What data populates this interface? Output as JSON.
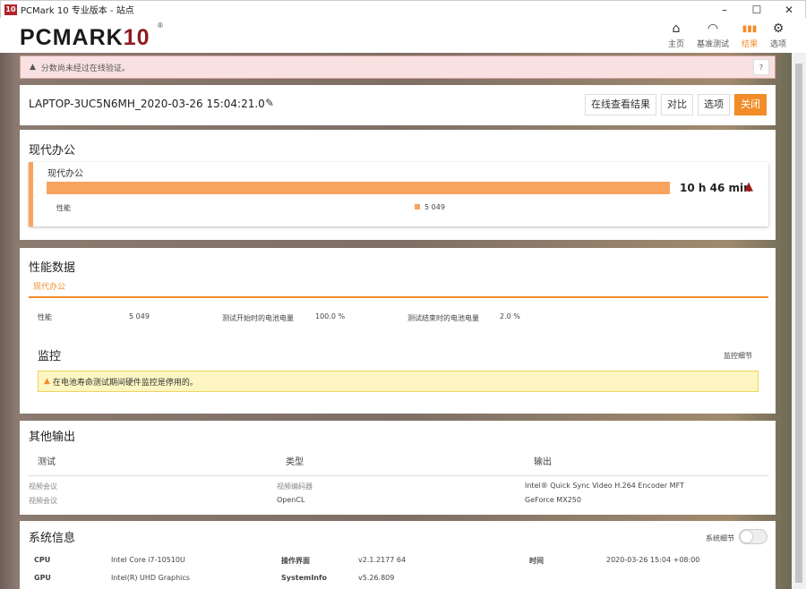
{
  "window": {
    "icon_text": "10",
    "title": "PCMark 10 专业版本 - 站点",
    "minimize": "–",
    "maximize": "☐",
    "close": "✕"
  },
  "logo": {
    "text_main": "PCMARK",
    "text_num": "10",
    "reg": "®"
  },
  "nav": [
    {
      "label": "主页",
      "icon": "home-icon",
      "glyph": "⌂"
    },
    {
      "label": "基准测试",
      "icon": "gauge-icon",
      "glyph": "◠"
    },
    {
      "label": "结果",
      "icon": "bar-chart-icon",
      "glyph": "▮▮▮"
    },
    {
      "label": "选项",
      "icon": "gear-icon",
      "glyph": "⚙"
    }
  ],
  "alert": {
    "text": "分数尚未经过在线验证。",
    "help": "?"
  },
  "result": {
    "title": "LAPTOP-3UC5N6MH_2020-03-26 15:04:21.0",
    "buttons": {
      "online": "在线查看结果",
      "compare": "对比",
      "options": "选项",
      "close": "关闭"
    }
  },
  "modern_office": {
    "heading": "现代办公",
    "card_title": "现代办公",
    "duration": "10 h 46 min",
    "perf_label": "性能",
    "perf_value": "5 049",
    "accent": "#f8a35e"
  },
  "perf_data": {
    "heading": "性能数据",
    "tab": "现代办公",
    "items": [
      {
        "label": "性能",
        "value": "5 049"
      },
      {
        "label": "测试开始时的电池电量",
        "value": "100.0 %"
      },
      {
        "label": "测试结束时的电池电量",
        "value": "2.0 %"
      }
    ],
    "monitor_heading": "监控",
    "monitor_detail": "监控细节",
    "monitor_warning": "在电池寿命测试期间硬件监控是停用的。"
  },
  "other_output": {
    "heading": "其他输出",
    "columns": [
      "测试",
      "类型",
      "输出"
    ],
    "rows": [
      [
        "视频会议",
        "视频编码器",
        "Intel® Quick Sync Video H.264 Encoder MFT"
      ],
      [
        "视频会议",
        "OpenCL",
        "GeForce MX250"
      ]
    ]
  },
  "sysinfo": {
    "heading": "系统信息",
    "toggle_label": "系统细节",
    "rows": [
      [
        {
          "k": "CPU",
          "v": "Intel Core i7-10510U"
        },
        {
          "k": "操作界面",
          "v": "v2.1.2177 64"
        },
        {
          "k": "时间",
          "v": "2020-03-26 15:04 +08:00"
        }
      ],
      [
        {
          "k": "GPU",
          "v": "Intel(R) UHD Graphics"
        },
        {
          "k": "SystemInfo",
          "v": "v5.26.809"
        }
      ]
    ]
  }
}
